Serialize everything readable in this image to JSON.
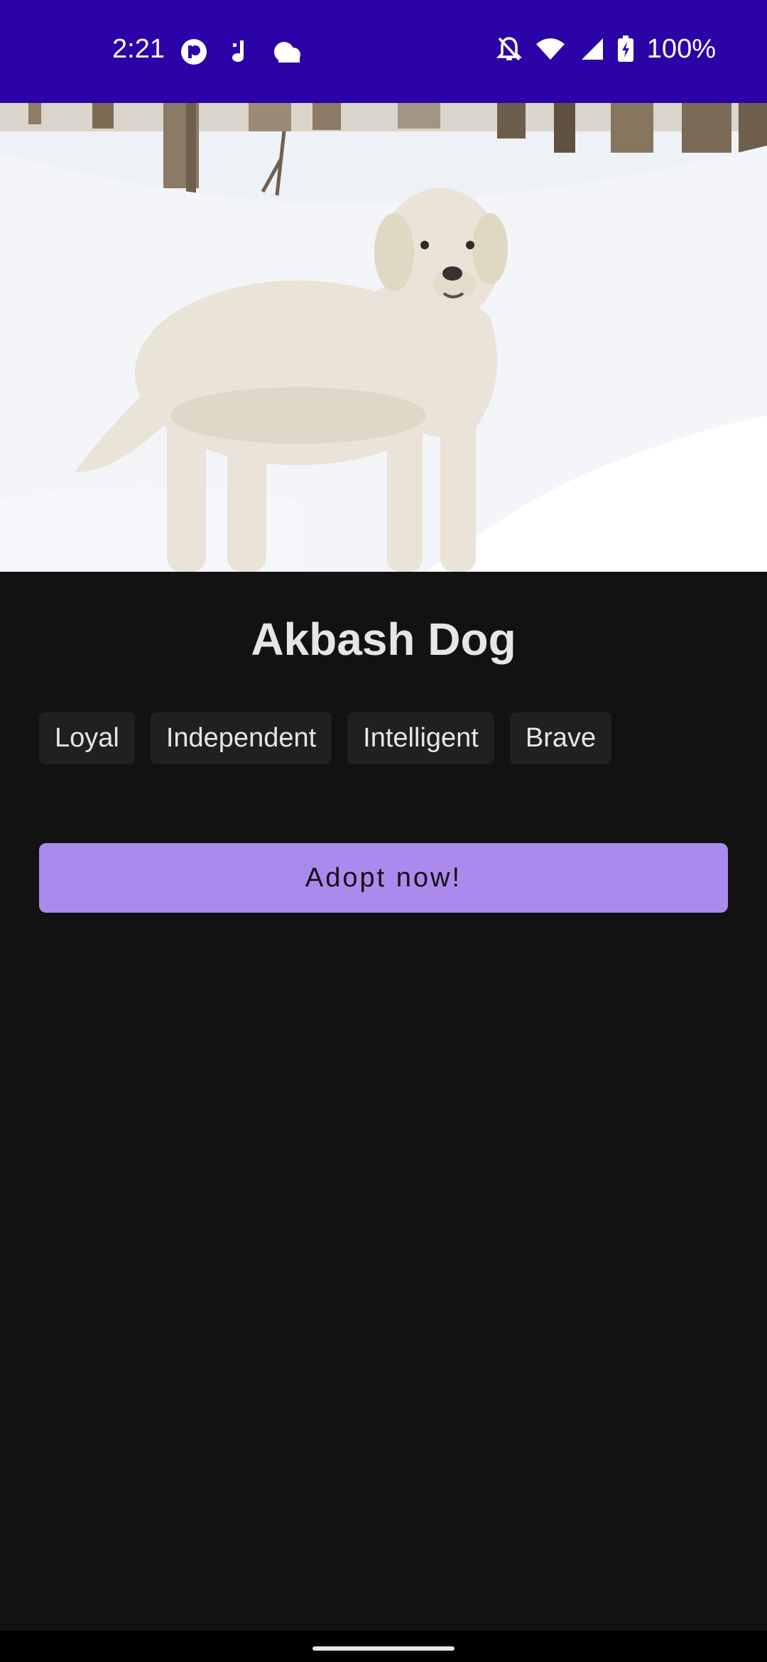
{
  "status_bar": {
    "time": "2:21",
    "battery": "100%",
    "icons": [
      "pocket-casts-icon",
      "music-note-icon",
      "cloud-icon",
      "bell-off-icon",
      "wifi-icon",
      "signal-icon",
      "battery-charging-icon"
    ]
  },
  "hero": {
    "image": "akbash-dog-photo"
  },
  "dog": {
    "name": "Akbash Dog",
    "traits": [
      "Loyal",
      "Independent",
      "Intelligent",
      "Brave"
    ]
  },
  "actions": {
    "adopt_label": "Adopt now!"
  },
  "colors": {
    "status_bar": "#2c03a6",
    "background": "#121212",
    "chip_bg": "#202020",
    "button": "#ab8aed",
    "text": "#e6e6e6"
  }
}
